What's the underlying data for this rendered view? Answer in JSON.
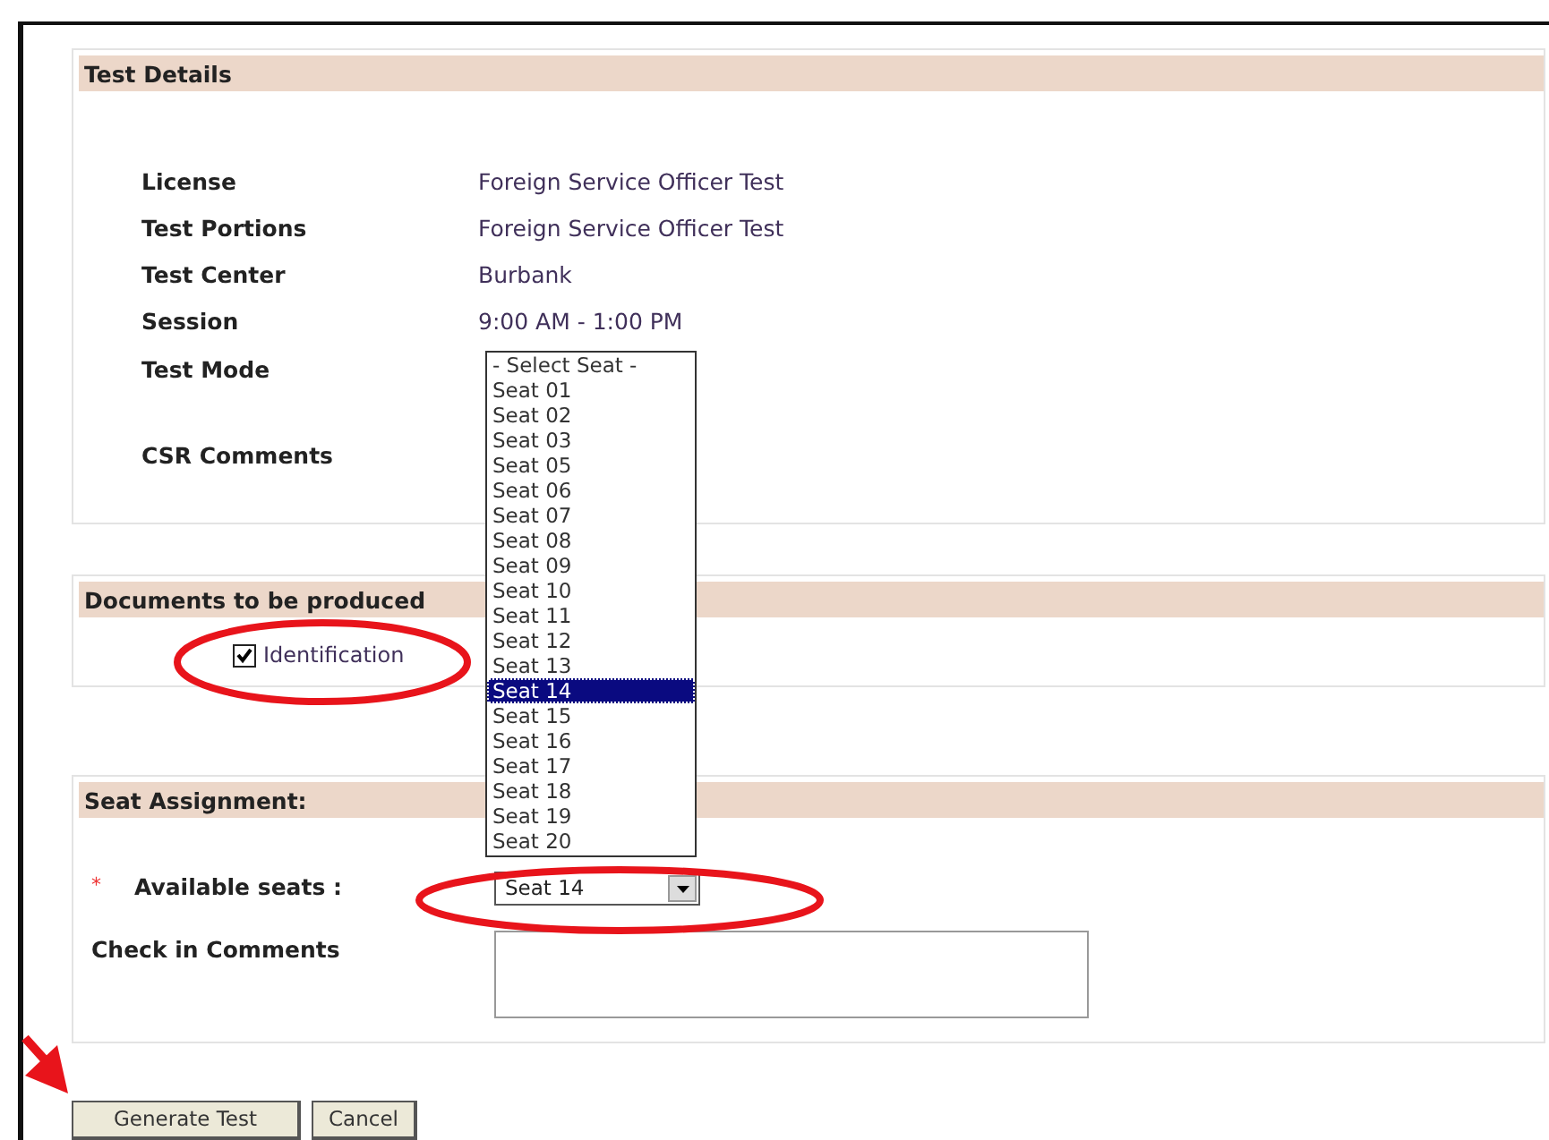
{
  "test_details": {
    "title": "Test Details",
    "fields": [
      {
        "label": "License",
        "value": "Foreign Service Officer Test"
      },
      {
        "label": "Test Portions",
        "value": "Foreign Service Officer Test"
      },
      {
        "label": "Test Center",
        "value": "Burbank"
      },
      {
        "label": "Session",
        "value": "9:00 AM - 1:00 PM"
      },
      {
        "label": "Test Mode"
      },
      {
        "label": "CSR Comments"
      }
    ]
  },
  "documents": {
    "title": "Documents to be produced",
    "items": [
      {
        "label": "Identification",
        "checked": true
      }
    ]
  },
  "seat_assignment": {
    "title": "Seat Assignment:",
    "required_mark": "*",
    "seat_label": "Available seats :",
    "seat_value": "Seat 14",
    "comments_label": "Check in Comments"
  },
  "seat_dropdown": {
    "options": [
      {
        "label": "- Select Seat -",
        "selected": false
      },
      {
        "label": "Seat 01",
        "selected": false
      },
      {
        "label": "Seat 02",
        "selected": false
      },
      {
        "label": "Seat 03",
        "selected": false
      },
      {
        "label": "Seat 05",
        "selected": false
      },
      {
        "label": "Seat 06",
        "selected": false
      },
      {
        "label": "Seat 07",
        "selected": false
      },
      {
        "label": "Seat 08",
        "selected": false
      },
      {
        "label": "Seat 09",
        "selected": false
      },
      {
        "label": "Seat 10",
        "selected": false
      },
      {
        "label": "Seat 11",
        "selected": false
      },
      {
        "label": "Seat 12",
        "selected": false
      },
      {
        "label": "Seat 13",
        "selected": false
      },
      {
        "label": "Seat 14",
        "selected": true
      },
      {
        "label": "Seat 15",
        "selected": false
      },
      {
        "label": "Seat 16",
        "selected": false
      },
      {
        "label": "Seat 17",
        "selected": false
      },
      {
        "label": "Seat 18",
        "selected": false
      },
      {
        "label": "Seat 19",
        "selected": false
      },
      {
        "label": "Seat 20",
        "selected": false
      }
    ]
  },
  "buttons": [
    {
      "label": "Generate Test"
    },
    {
      "label": "Cancel"
    }
  ]
}
